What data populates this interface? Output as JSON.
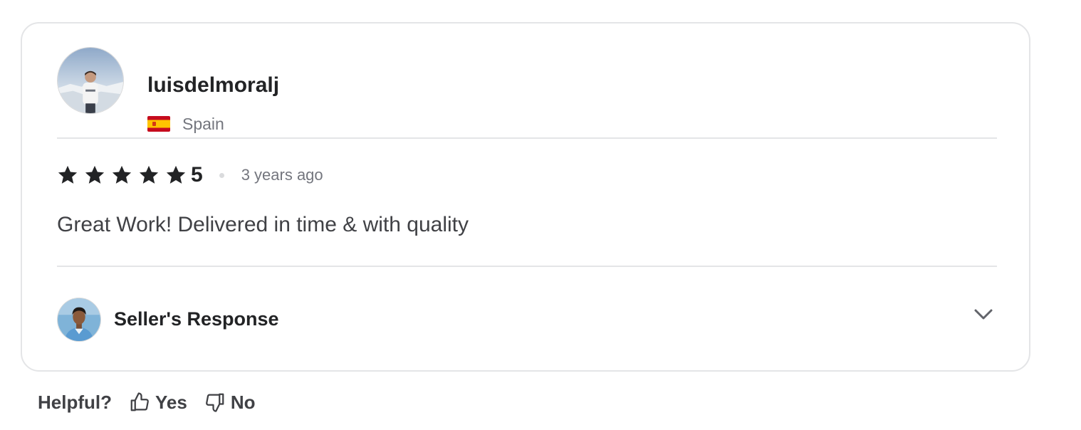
{
  "reviewer": {
    "username": "luisdelmoralj",
    "country": "Spain",
    "flag_icon": "spain-flag-icon",
    "avatar_icon": "reviewer-avatar"
  },
  "review": {
    "stars": 5,
    "score_text": "5",
    "time_ago": "3 years ago",
    "text": "Great Work! Delivered in time & with quality"
  },
  "seller_response": {
    "label": "Seller's Response",
    "avatar_icon": "seller-avatar",
    "expand_icon": "chevron-down-icon"
  },
  "helpful": {
    "label": "Helpful?",
    "yes_label": "Yes",
    "no_label": "No",
    "yes_icon": "thumbs-up-icon",
    "no_icon": "thumbs-down-icon"
  },
  "colors": {
    "text_primary": "#222325",
    "text_secondary": "#74767e",
    "border": "#e4e5e7",
    "star": "#222325"
  }
}
